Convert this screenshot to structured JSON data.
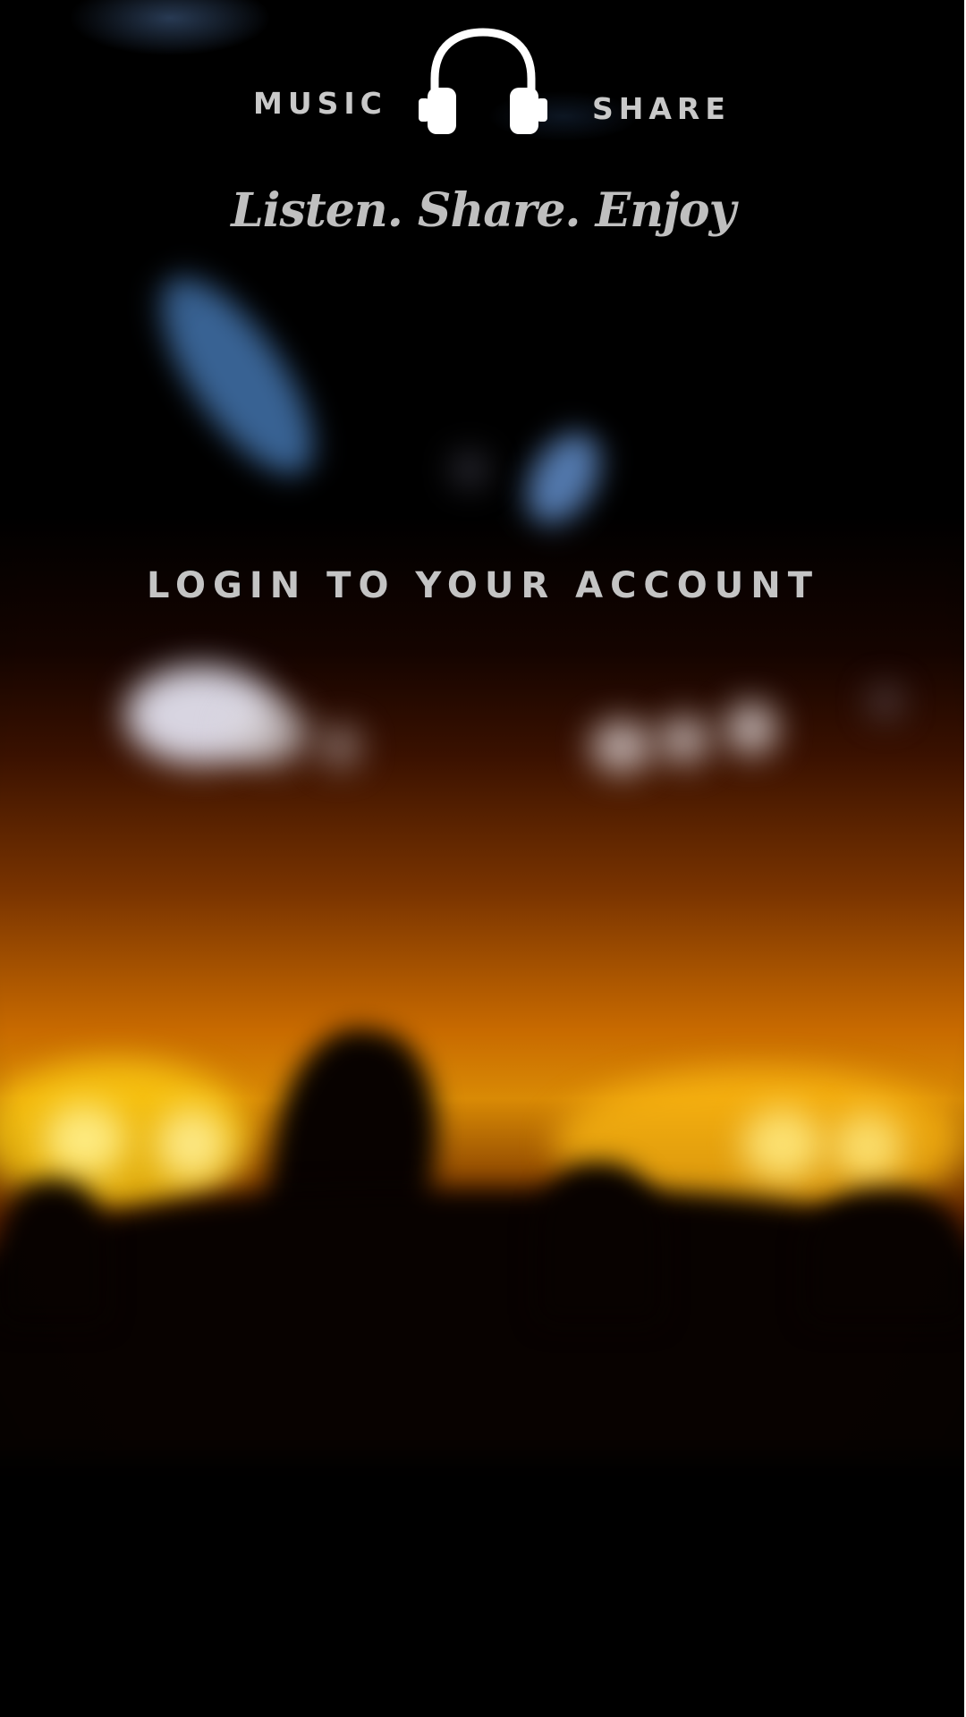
{
  "header": {
    "brand_left": "MUSIC",
    "brand_right": "SHARE",
    "logo_icon": "headphones-icon",
    "tagline": "Listen. Share. Enjoy"
  },
  "main": {
    "title": "LOGIN TO YOUR ACCOUNT"
  },
  "colors": {
    "text": "#c9c9c9",
    "background": "#000000",
    "glow_orange": "#d98a05",
    "glow_blue": "#6ea0e6"
  }
}
